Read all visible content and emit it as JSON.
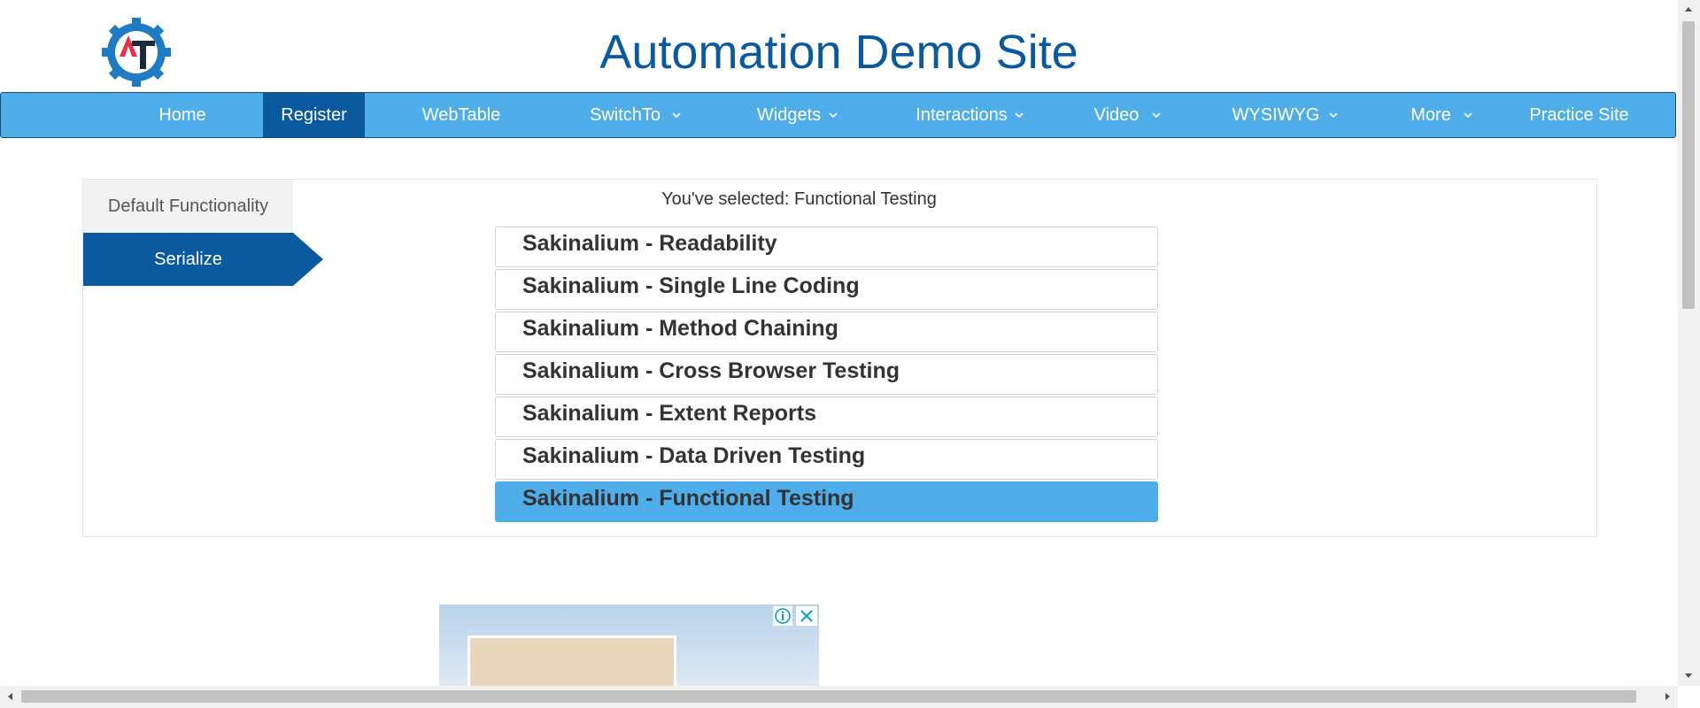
{
  "header": {
    "logo_icon": "automation-testing-gear-logo",
    "title": "Automation Demo Site"
  },
  "nav": {
    "items": [
      {
        "label": "Home"
      },
      {
        "label": "Register",
        "active": true
      },
      {
        "label": "WebTable"
      },
      {
        "label": "SwitchTo",
        "dropdown": true
      },
      {
        "label": "Widgets",
        "dropdown": true
      },
      {
        "label": "Interactions",
        "dropdown": true
      },
      {
        "label": "Video",
        "dropdown": true
      },
      {
        "label": "WYSIWYG",
        "dropdown": true
      },
      {
        "label": "More",
        "dropdown": true
      },
      {
        "label": "Practice Site"
      }
    ]
  },
  "tabs": {
    "default_label": "Default Functionality",
    "serialize_label": "Serialize",
    "active": "Serialize"
  },
  "selectable": {
    "selected_text": "You've selected: Functional Testing",
    "items": [
      "Sakinalium - Readability",
      "Sakinalium - Single Line Coding",
      "Sakinalium - Method Chaining",
      "Sakinalium - Cross Browser Testing",
      "Sakinalium - Extent Reports",
      "Sakinalium - Data Driven Testing",
      "Sakinalium - Functional Testing"
    ],
    "selected_index": 6
  },
  "ad": {
    "info_icon": "info-icon",
    "close_icon": "close-icon"
  },
  "colors": {
    "brand_blue": "#0b5aa0",
    "nav_blue": "#4fadea",
    "selected_bg": "#4fadea"
  }
}
